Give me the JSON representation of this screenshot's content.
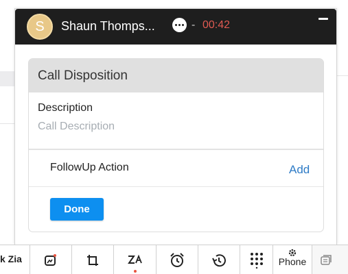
{
  "call": {
    "avatar_initial": "S",
    "caller_name": "Shaun Thomps...",
    "separator": "-",
    "timer": "00:42"
  },
  "disposition": {
    "title": "Call Disposition",
    "description_label": "Description",
    "description_placeholder": "Call Description",
    "description_value": "",
    "followup_label": "FollowUp Action",
    "add_label": "Add",
    "done_label": "Done"
  },
  "toolbar": {
    "zia_label": "k Zia",
    "phone_label": "Phone",
    "icons": [
      "ask-zia",
      "image-sparkle-icon",
      "crop-transfer-icon",
      "zia-signature-icon",
      "alarm-clock-icon",
      "history-icon",
      "dialpad-icon",
      "gear-icon",
      "chat-bubbles-icon"
    ]
  },
  "colors": {
    "header_bg": "#1e1e1e",
    "timer": "#e05a52",
    "accent_button": "#0d8ff0",
    "link": "#2e7bc6",
    "card_header_bg": "#e0e0e0"
  }
}
